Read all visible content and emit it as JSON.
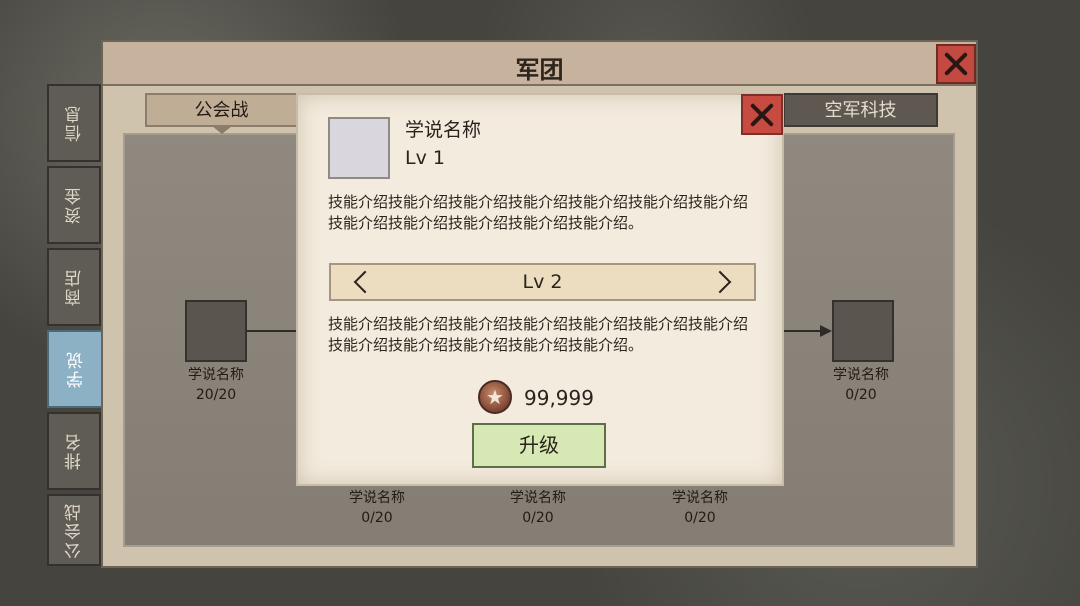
{
  "window": {
    "title": "军团"
  },
  "side_tabs": [
    "信息",
    "资金",
    "商店",
    "学说",
    "排名",
    "公会战"
  ],
  "active_side_tab": "学说",
  "sub_tabs": {
    "left": "公会战",
    "right": "空军科技"
  },
  "tree_nodes": [
    {
      "name": "学说名称",
      "progress": "20/20"
    },
    {
      "name": "学说名称",
      "progress": "0/20"
    },
    {
      "name": "学说名称",
      "progress": "0/20"
    },
    {
      "name": "学说名称",
      "progress": "0/20"
    },
    {
      "name": "学说名称",
      "progress": "0/20"
    }
  ],
  "dialog": {
    "skill_name": "学说名称",
    "current_level": "Lv 1",
    "current_desc": "技能介绍技能介绍技能介绍技能介绍技能介绍技能介绍技能介绍技能介绍技能介绍技能介绍技能介绍技能介绍。",
    "next_level": "Lv 2",
    "next_desc": "技能介绍技能介绍技能介绍技能介绍技能介绍技能介绍技能介绍技能介绍技能介绍技能介绍技能介绍技能介绍。",
    "cost": "99,999",
    "cost_icon": "star-medal-icon",
    "upgrade_label": "升级"
  },
  "colors": {
    "close_button": "#c84b42",
    "upgrade_button": "#d6e8b3",
    "active_tab": "#8cb0c4"
  }
}
